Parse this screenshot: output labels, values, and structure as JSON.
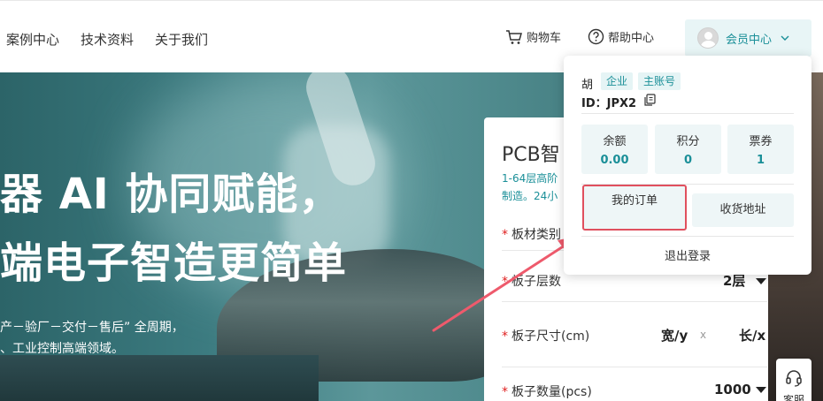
{
  "nav": {
    "links": [
      "案例中心",
      "技术资料",
      "关于我们"
    ]
  },
  "utilities": {
    "cart_label": "购物车",
    "help_label": "帮助中心",
    "member_label": "会员中心"
  },
  "hero": {
    "title_line1": "器 AI 协同赋能，",
    "title_line2": "端电子智造更简单",
    "sub_line1": "产－验厂－交付－售后” 全周期，",
    "sub_line2": "、工业控制高端领域。"
  },
  "quote_card": {
    "title": "PCB智",
    "desc_line1": "1-64层高阶",
    "desc_line2": "制造。24小",
    "rows": {
      "material": {
        "label": "板材类别"
      },
      "layers": {
        "label": "板子层数",
        "value": "2层"
      },
      "size": {
        "label": "板子尺寸(cm)",
        "width": "宽/y",
        "sep": "x",
        "length": "长/x"
      },
      "quantity": {
        "label": "板子数量(pcs)",
        "value": "1000"
      }
    },
    "required_mark": "*"
  },
  "service": {
    "label": "客服"
  },
  "member_dropdown": {
    "name": "胡",
    "tags": [
      "企业",
      "主账号"
    ],
    "id_text": "ID：JPX2",
    "stats": [
      {
        "label": "余额",
        "value": "0.00"
      },
      {
        "label": "积分",
        "value": "0"
      },
      {
        "label": "票券",
        "value": "1"
      }
    ],
    "my_orders": "我的订单",
    "address": "收货地址",
    "logout": "退出登录"
  },
  "colors": {
    "accent": "#1a8f98",
    "highlight_box": "#e0505e",
    "arrow": "#ee5a6c"
  }
}
